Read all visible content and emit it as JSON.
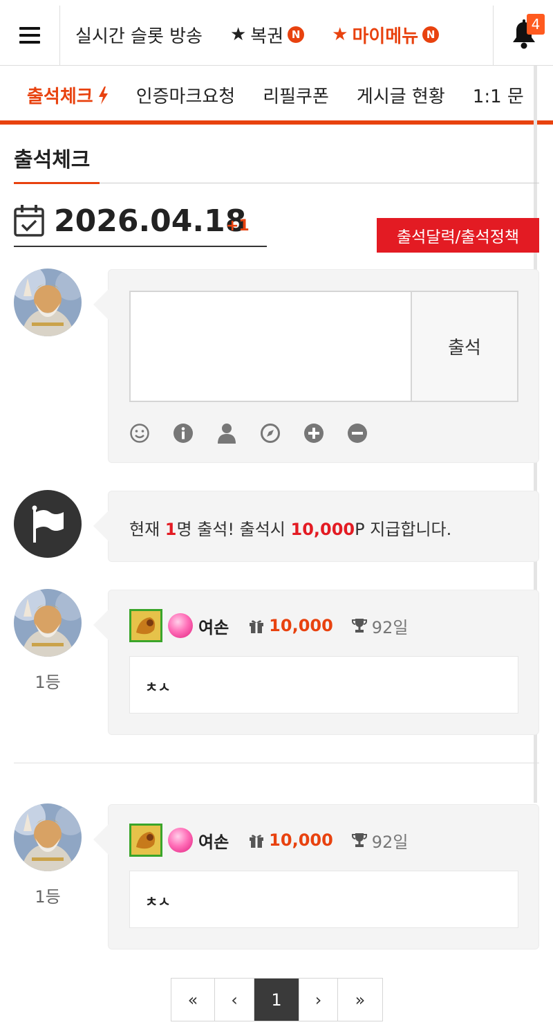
{
  "topbar": {
    "menu": [
      {
        "label": "실시간 슬롯 방송",
        "star": "",
        "badge": ""
      },
      {
        "label": "복권",
        "star": "★",
        "badge": "N"
      },
      {
        "label": "마이메뉴",
        "star": "★",
        "badge": "N"
      }
    ],
    "notification_count": "4"
  },
  "subnav": {
    "items": [
      "출석체크",
      "인증마크요청",
      "리필쿠폰",
      "게시글 현황",
      "1:1 문"
    ]
  },
  "page": {
    "title": "출석체크",
    "date": "2026.04.18",
    "date_delta": "+1",
    "policy_button": "출석달력/출석정책"
  },
  "form": {
    "submit_label": "출석",
    "textarea_value": "",
    "tools": [
      "smiley-icon",
      "info-icon",
      "user-icon",
      "compass-icon",
      "plus-circle-icon",
      "minus-circle-icon"
    ]
  },
  "notice": {
    "prefix": "현재 ",
    "count": "1",
    "middle": "명 출석! 출석시 ",
    "points": "10,000",
    "suffix": "P 지급합니다."
  },
  "entries": [
    {
      "rank": "1등",
      "nickname": "여손",
      "points": "10,000",
      "days": "92일",
      "comment": "ㅊㅅ"
    },
    {
      "rank": "1등",
      "nickname": "여손",
      "points": "10,000",
      "days": "92일",
      "comment": "ㅊㅅ"
    }
  ],
  "pagination": {
    "first": "«",
    "prev": "‹",
    "current": "1",
    "next": "›",
    "last": "»"
  },
  "colors": {
    "accent": "#e8420f",
    "policy_button": "#e31b23",
    "active_page": "#3a3a3a"
  }
}
